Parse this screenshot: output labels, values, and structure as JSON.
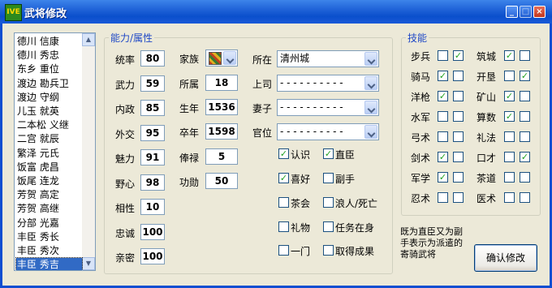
{
  "window": {
    "title": "武将修改",
    "icon_text": "IVE"
  },
  "officer_list": [
    "德川 信康",
    "德川 秀忠",
    "东乡 重位",
    "渡边 勘兵卫",
    "渡边 守纲",
    "儿玉 就英",
    "二本松 义继",
    "二宫 就辰",
    "繁泽 元氏",
    "饭富 虎昌",
    "饭尾 连龙",
    "芳贺 高定",
    "芳贺 高继",
    "分部 光嘉",
    "丰臣 秀长",
    "丰臣 秀次",
    "丰臣 秀吉"
  ],
  "selected_officer": "丰臣 秀吉",
  "ability": {
    "group_label": "能力/属性",
    "stats": [
      {
        "label": "统率",
        "value": "80"
      },
      {
        "label": "武力",
        "value": "59"
      },
      {
        "label": "内政",
        "value": "85"
      },
      {
        "label": "外交",
        "value": "95"
      },
      {
        "label": "魅力",
        "value": "91"
      },
      {
        "label": "野心",
        "value": "98"
      },
      {
        "label": "相性",
        "value": "10"
      },
      {
        "label": "忠诚",
        "value": "100"
      },
      {
        "label": "亲密",
        "value": "100"
      }
    ],
    "family": {
      "label": "家族",
      "icon": "family-crest-icon"
    },
    "attrs": [
      {
        "label": "所属",
        "value": "18"
      },
      {
        "label": "生年",
        "value": "1536"
      },
      {
        "label": "卒年",
        "value": "1598"
      },
      {
        "label": "俸禄",
        "value": "5"
      },
      {
        "label": "功勋",
        "value": "50"
      }
    ],
    "location": {
      "label": "所在",
      "value": "清州城"
    },
    "superior": {
      "label": "上司",
      "value": "- - - - - - - - - -"
    },
    "wife": {
      "label": "妻子",
      "value": "- - - - - - - - - -"
    },
    "rank": {
      "label": "官位",
      "value": "- - - - - - - - - -"
    },
    "flags": [
      {
        "label": "认识",
        "checked": true
      },
      {
        "label": "直臣",
        "checked": true
      },
      {
        "label": "喜好",
        "checked": true
      },
      {
        "label": "副手",
        "checked": false
      },
      {
        "label": "茶会",
        "checked": false
      },
      {
        "label": "浪人/死亡",
        "checked": false
      },
      {
        "label": "礼物",
        "checked": false
      },
      {
        "label": "任务在身",
        "checked": false
      },
      {
        "label": "一门",
        "checked": false
      },
      {
        "label": "取得成果",
        "checked": false
      }
    ]
  },
  "skills": {
    "group_label": "技能",
    "items": [
      {
        "label": "步兵",
        "a": false,
        "b": true
      },
      {
        "label": "筑城",
        "a": true,
        "b": false
      },
      {
        "label": "骑马",
        "a": true,
        "b": false
      },
      {
        "label": "开垦",
        "a": false,
        "b": true
      },
      {
        "label": "洋枪",
        "a": true,
        "b": false
      },
      {
        "label": "矿山",
        "a": true,
        "b": false
      },
      {
        "label": "水军",
        "a": false,
        "b": false
      },
      {
        "label": "算数",
        "a": true,
        "b": false
      },
      {
        "label": "弓术",
        "a": false,
        "b": false
      },
      {
        "label": "礼法",
        "a": false,
        "b": false
      },
      {
        "label": "剑术",
        "a": true,
        "b": false
      },
      {
        "label": "口才",
        "a": false,
        "b": true
      },
      {
        "label": "军学",
        "a": true,
        "b": false
      },
      {
        "label": "茶道",
        "a": false,
        "b": false
      },
      {
        "label": "忍术",
        "a": false,
        "b": false
      },
      {
        "label": "医术",
        "a": false,
        "b": false
      }
    ]
  },
  "note": "既为直臣又为副手表示为派遣的寄骑武将",
  "confirm_button": "确认修改",
  "colors": {
    "titlebar": "#0a4fcc",
    "group_label": "#1f48c6",
    "selection": "#316ac5",
    "check": "#21a121"
  }
}
